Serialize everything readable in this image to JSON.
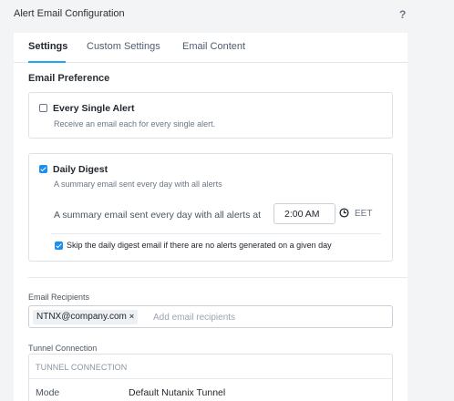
{
  "header": {
    "title": "Alert Email Configuration",
    "help_label": "?"
  },
  "tabs": [
    {
      "label": "Settings",
      "active": true
    },
    {
      "label": "Custom Settings",
      "active": false
    },
    {
      "label": "Email Content",
      "active": false
    }
  ],
  "email_preference": {
    "heading": "Email Preference",
    "every_single_alert": {
      "label": "Every Single Alert",
      "description": "Receive an email each for every single alert.",
      "checked": false
    },
    "daily_digest": {
      "label": "Daily Digest",
      "description": "A summary email sent every day with all alerts",
      "checked": true,
      "schedule_text": "A summary email sent every day with all alerts at",
      "time_value": "2:00 AM",
      "timezone": "EET",
      "skip_empty": {
        "label": "Skip the daily digest email if there are no alerts generated on a given day",
        "checked": true
      }
    }
  },
  "email_recipients": {
    "label": "Email Recipients",
    "chips": [
      {
        "label": "NTNX@company.com",
        "remove_label": "×"
      }
    ],
    "placeholder": "Add email recipients"
  },
  "tunnel_connection": {
    "label": "Tunnel Connection",
    "card_heading": "TUNNEL CONNECTION",
    "mode_label": "Mode",
    "mode_value": "Default Nutanix Tunnel"
  },
  "colors": {
    "accent": "#22a5f7",
    "checkbox_checked": "#1b8ff0",
    "page_background": "#f2f4f6"
  },
  "icons": {
    "clock": "clock-icon",
    "help": "help-icon",
    "checkbox_checked": "checkmark-icon"
  }
}
